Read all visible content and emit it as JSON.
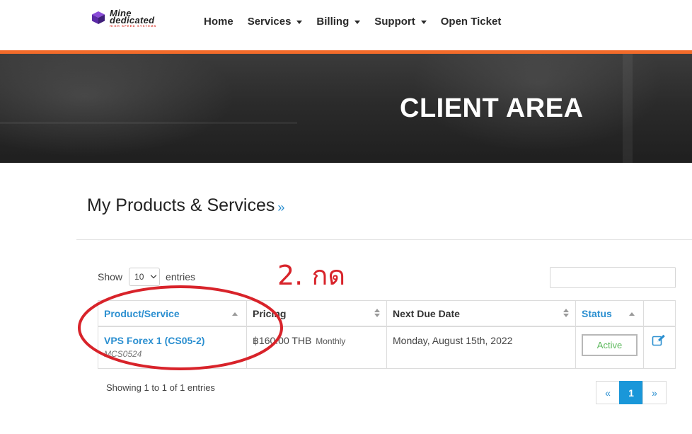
{
  "header": {
    "logo": {
      "line1": "Mine",
      "line2": "dedicated",
      "tagline": "HIGH SPEED SYSTEMS"
    },
    "nav": [
      {
        "label": "Home",
        "dropdown": false
      },
      {
        "label": "Services",
        "dropdown": true
      },
      {
        "label": "Billing",
        "dropdown": true
      },
      {
        "label": "Support",
        "dropdown": true
      },
      {
        "label": "Open Ticket",
        "dropdown": false
      }
    ]
  },
  "hero": {
    "title": "CLIENT AREA"
  },
  "page": {
    "title": "My Products & Services",
    "title_suffix": "»"
  },
  "table_controls": {
    "show_label": "Show",
    "entries_value": "10",
    "entries_label": "entries",
    "search_placeholder": ""
  },
  "table": {
    "columns": [
      {
        "label": "Product/Service",
        "sort": "asc",
        "active": true
      },
      {
        "label": "Pricing",
        "sort": "both",
        "active": false
      },
      {
        "label": "Next Due Date",
        "sort": "both",
        "active": false
      },
      {
        "label": "Status",
        "sort": "asc",
        "active": true
      },
      {
        "label": "",
        "sort": "none",
        "active": false
      }
    ],
    "rows": [
      {
        "product": "VPS Forex 1 (CS05-2)",
        "product_code": "MCS0524",
        "price": "฿160.00 THB",
        "cycle": "Monthly",
        "next_due": "Monday, August 15th, 2022",
        "status": "Active"
      }
    ],
    "info": "Showing 1 to 1 of 1 entries"
  },
  "pagination": {
    "prev": "«",
    "current": "1",
    "next": "»"
  },
  "annotation": {
    "text": "2. กด"
  },
  "colors": {
    "accent": "#2b8fd0",
    "nav_bar": "#f26b2a",
    "status_active": "#5cb85c",
    "pagination_active": "#1a97d9",
    "annotation": "#d8232a"
  },
  "icons": {
    "edit": "edit-icon",
    "logo": "logo-cube-icon"
  }
}
